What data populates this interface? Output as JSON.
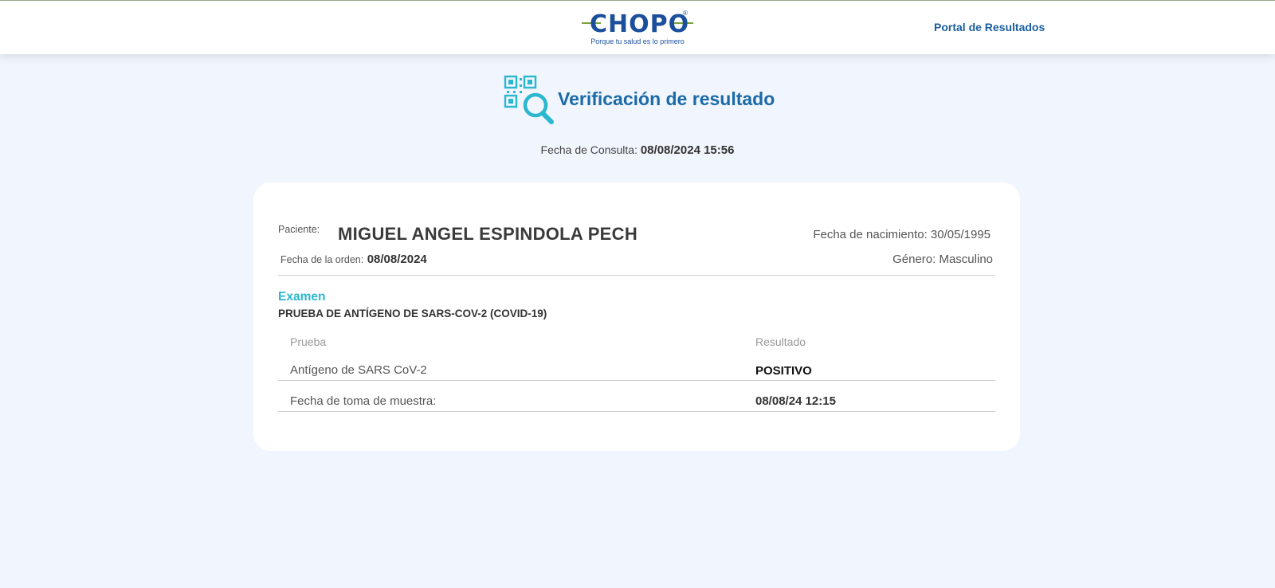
{
  "header": {
    "logo_text": "CHOPO",
    "logo_registered": "®",
    "logo_tagline": "Porque tu salud es lo primero",
    "portal_link": "Portal de Resultados"
  },
  "page": {
    "icon": "qr-search-icon",
    "title": "Verificación de resultado",
    "consulta_label": "Fecha de Consulta:",
    "consulta_value": "08/08/2024 15:56"
  },
  "patient": {
    "label": "Paciente:",
    "name": "MIGUEL ANGEL ESPINDOLA PECH",
    "order_label": "Fecha de la orden:",
    "order_date": "08/08/2024",
    "birth_label": "Fecha de nacimiento:",
    "birth_date": "30/05/1995",
    "gender_label": "Género:",
    "gender": "Masculino"
  },
  "exam": {
    "label": "Examen",
    "name": "PRUEBA DE ANTÍGENO DE SARS-COV-2 (COVID-19)",
    "columns": {
      "test": "Prueba",
      "result": "Resultado"
    },
    "rows": [
      {
        "test": "Antígeno de SARS CoV-2",
        "result": "POSITIVO"
      },
      {
        "test": "Fecha de toma de muestra:",
        "result": "08/08/24 12:15"
      }
    ]
  },
  "colors": {
    "brand_blue": "#1b4f9c",
    "title_blue": "#1a6aa8",
    "accent_cyan": "#2ab7cf",
    "logo_green": "#7aa23d",
    "background": "#f1f5fd"
  }
}
